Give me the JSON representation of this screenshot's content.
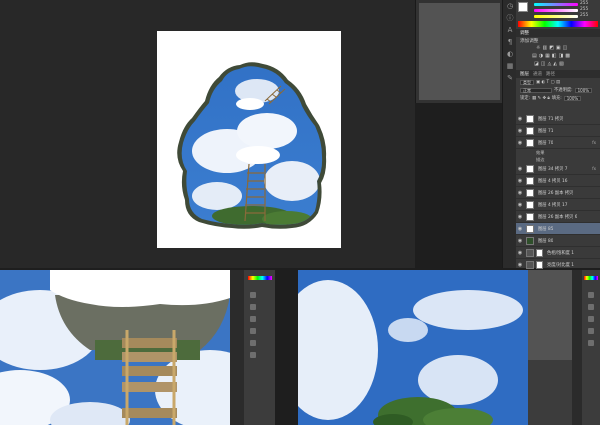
{
  "main_window": {
    "background": "#282828",
    "document_background": "#ffffff"
  },
  "floating_panel": {
    "background": "#535353"
  },
  "toolbar_icons": [
    "history-icon",
    "info-icon",
    "character-icon",
    "paragraph-icon",
    "adjust-icon",
    "styles-icon",
    "brush-icon"
  ],
  "color_panel": {
    "sliders": [
      {
        "label": "",
        "value": "255",
        "color": "#d02020"
      },
      {
        "label": "",
        "value": "255",
        "color": "#20c020"
      },
      {
        "label": "",
        "value": "255",
        "color": "#2050e0"
      }
    ]
  },
  "adjustments_panel": {
    "tab": "调整",
    "subtitle": "添加调整"
  },
  "layers_panel": {
    "tabs": [
      "图层",
      "通道",
      "路径"
    ],
    "kind_label": "类型",
    "blend_mode": "正常",
    "opacity_label": "不透明度:",
    "opacity_value": "100%",
    "lock_label": "锁定:",
    "fill_label": "填充:",
    "fill_value": "100%",
    "layers": [
      {
        "name": "图层 71 拷贝",
        "thumb": "white",
        "selected": false
      },
      {
        "name": "图层 71",
        "thumb": "white",
        "selected": false
      },
      {
        "name": "图层 70",
        "thumb": "white",
        "selected": false,
        "fx": "fx"
      },
      {
        "name": "图层 34 拷贝 7",
        "thumb": "white",
        "selected": false,
        "fx": "fx"
      },
      {
        "name": "图层 4 拷贝 16",
        "thumb": "white",
        "selected": false
      },
      {
        "name": "图层 26 副本 拷贝",
        "thumb": "white",
        "selected": false
      },
      {
        "name": "图层 4 拷贝 17",
        "thumb": "white",
        "selected": false
      },
      {
        "name": "图层 26 副本 拷贝 6",
        "thumb": "white",
        "selected": false
      },
      {
        "name": "图层 85",
        "thumb": "white",
        "selected": true
      },
      {
        "name": "图层 80",
        "thumb": "tree",
        "selected": false
      },
      {
        "name": "色相/饱和度 1",
        "thumb": "dark",
        "selected": false,
        "mask": true
      },
      {
        "name": "亮度/对比度 1",
        "thumb": "dark",
        "selected": false,
        "mask": true
      },
      {
        "name": "图层 1",
        "thumb": "blue",
        "selected": false
      }
    ],
    "effects": [
      "效果",
      "描边"
    ]
  },
  "bottom_left_window": {
    "content": "zoomed-rope-ladder-view"
  },
  "bottom_right_window": {
    "content": "zoomed-sky-trees-view"
  }
}
